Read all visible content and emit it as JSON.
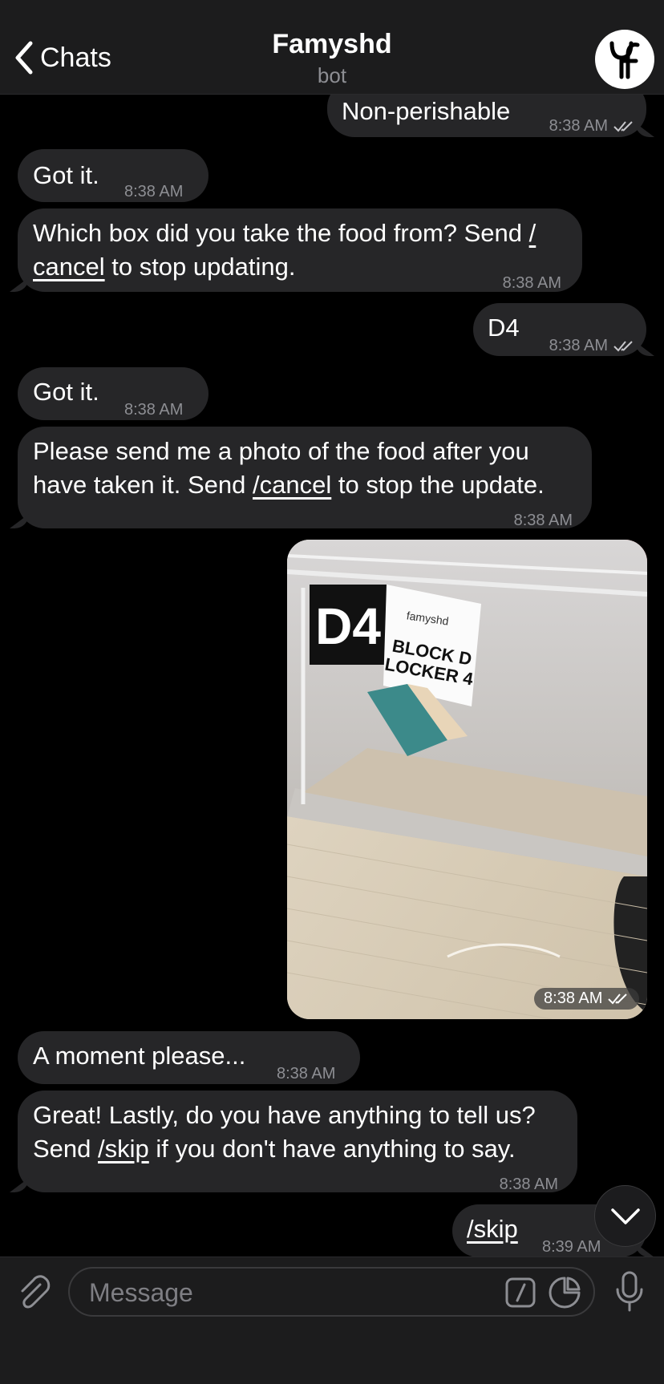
{
  "header": {
    "back_label": "Chats",
    "title": "Famyshd",
    "subtitle": "bot"
  },
  "messages": [
    {
      "id": "m1",
      "dir": "out",
      "text": "Non-perishable",
      "time": "8:38 AM",
      "read": true
    },
    {
      "id": "m2",
      "dir": "in",
      "text": "Got it.",
      "time": "8:38 AM"
    },
    {
      "id": "m3",
      "dir": "in",
      "line1_pre": "Which box did you take the food from? Send ",
      "line1_cmd": "/",
      "line2_cmd": "cancel",
      "line2_post": " to stop updating.",
      "time": "8:38 AM"
    },
    {
      "id": "m4",
      "dir": "out",
      "text": "D4",
      "time": "8:38 AM",
      "read": true
    },
    {
      "id": "m5",
      "dir": "in",
      "text": "Got it.",
      "time": "8:38 AM"
    },
    {
      "id": "m6",
      "dir": "in",
      "line1": "Please send me a photo of the food after you",
      "line2_pre": "have taken it. Send ",
      "line2_cmd": "/cancel",
      "line2_post": " to stop the update.",
      "time": "8:38 AM"
    },
    {
      "id": "m7",
      "dir": "out",
      "type": "photo",
      "time": "8:38 AM",
      "read": true,
      "photo_text": {
        "box_code": "D4",
        "brand": "famyshd",
        "label_line1": "BLOCK D",
        "label_line2": "LOCKER 4"
      }
    },
    {
      "id": "m8",
      "dir": "in",
      "text": "A moment please...",
      "time": "8:38 AM"
    },
    {
      "id": "m9",
      "dir": "in",
      "line1": "Great! Lastly, do you have anything to tell us?",
      "line2_pre": "Send ",
      "line2_cmd": "/skip",
      "line2_post": " if you don't have anything to say.",
      "time": "8:38 AM"
    },
    {
      "id": "m10",
      "dir": "out",
      "cmd": "/skip",
      "time": "8:39 AM"
    }
  ],
  "input": {
    "placeholder": "Message"
  },
  "icons": {
    "back": "chevron-left-icon",
    "attach": "paperclip-icon",
    "command": "slash-command-icon",
    "sticker": "sticker-icon",
    "mic": "microphone-icon",
    "scroll": "chevron-down-icon",
    "read": "double-check-icon"
  },
  "colors": {
    "background": "#000000",
    "bar": "#1c1c1d",
    "bubble": "#262628",
    "secondary_text": "#8d8e93"
  }
}
